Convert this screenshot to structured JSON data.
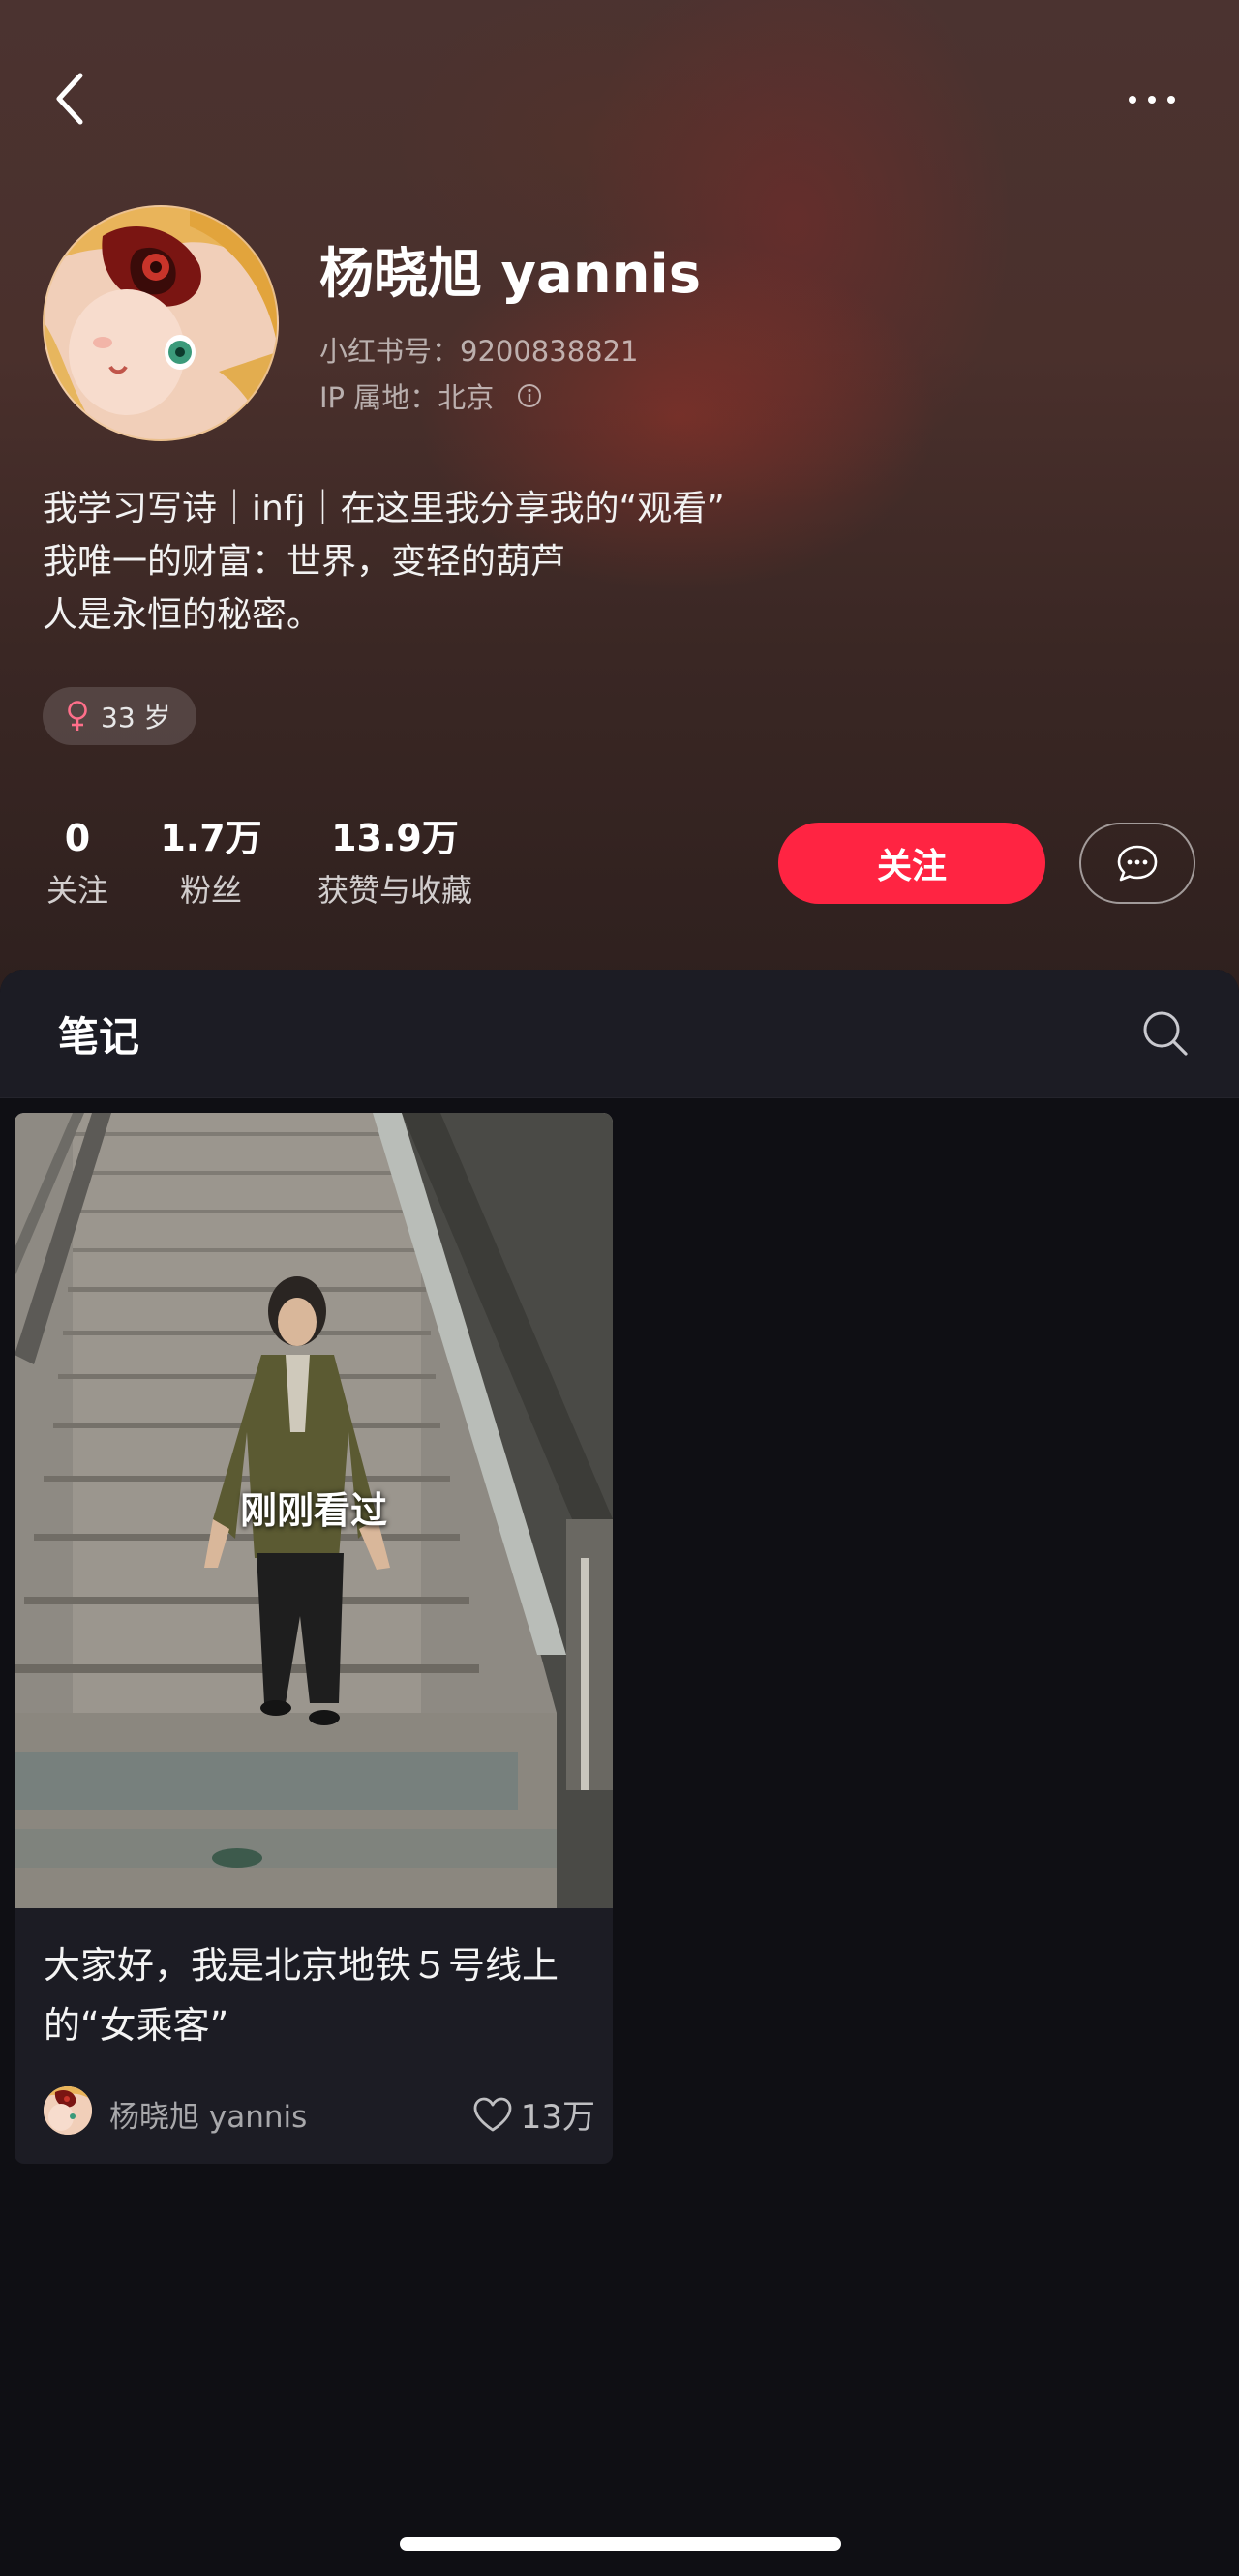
{
  "header": {
    "profile_name": "杨晓旭 yannis",
    "account_id": "小红书号：9200838821",
    "ip_location": "IP 属地：北京",
    "bio_lines": [
      "我学习写诗｜infj｜在这里我分享我的“观看”",
      "我唯一的财富：世界，变轻的葫芦",
      "人是永恒的秘密。"
    ],
    "age_tag": "33 岁",
    "stats": [
      {
        "value": "0",
        "label": "关注"
      },
      {
        "value": "1.7万",
        "label": "粉丝"
      },
      {
        "value": "13.9万",
        "label": "获赞与收藏"
      }
    ],
    "follow_label": "关注"
  },
  "icons": {
    "back": "chevron-left-icon",
    "more": "more-dots-icon",
    "info": "info-icon",
    "gender": "female-icon",
    "message": "chat-bubble-icon",
    "search": "search-icon",
    "like": "heart-icon"
  },
  "colors": {
    "accent": "#ff2442",
    "header_bg": "#4a302c",
    "panel_bg": "#0f0f14",
    "card_bg": "#1c1c24"
  },
  "tabs": {
    "notes_label": "笔记"
  },
  "notes": [
    {
      "overlay_label": "刚刚看过",
      "title": "大家好，我是北京地铁５号线上的“女乘客”",
      "author": "杨晓旭 yannis",
      "likes": "13万"
    }
  ]
}
